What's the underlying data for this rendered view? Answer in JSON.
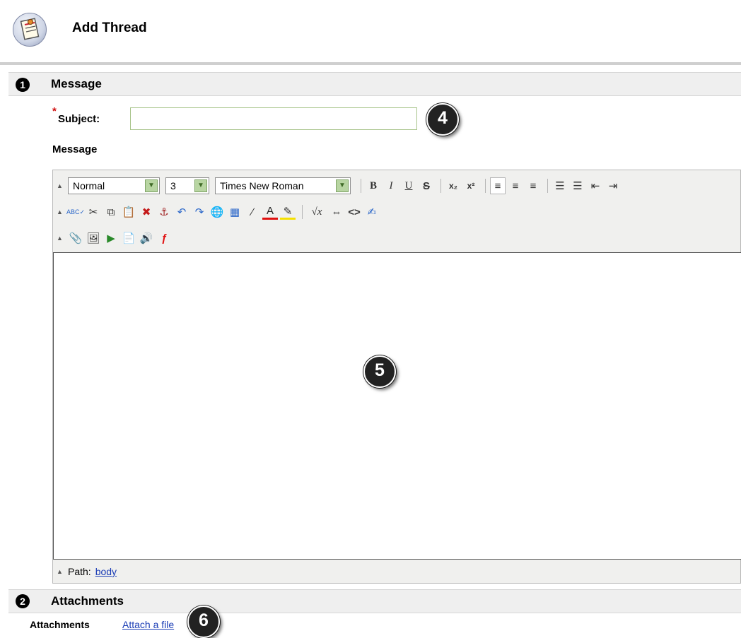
{
  "header": {
    "title": "Add Thread",
    "icon": "discussion-thread-icon"
  },
  "sections": {
    "message": {
      "number": "1",
      "title": "Message"
    },
    "attachments": {
      "number": "2",
      "title": "Attachments"
    }
  },
  "form": {
    "required_marker": "*",
    "subject_label": "Subject:",
    "subject_value": "",
    "message_label": "Message"
  },
  "editor": {
    "format_select": "Normal",
    "size_select": "3",
    "font_select": "Times New Roman",
    "row1": {
      "bold": "B",
      "italic": "I",
      "underline": "U",
      "strike": "S",
      "subscript": "x₂",
      "superscript": "x²",
      "align_left": "≡",
      "align_center": "≡",
      "align_right": "≡",
      "ordered_list": "☰",
      "unordered_list": "☰",
      "outdent": "⇤",
      "indent": "⇥"
    },
    "row2": {
      "spellcheck": "ABC✓",
      "cut": "✂",
      "copy": "⧉",
      "paste": "📋",
      "remove_format": "✖",
      "anchor": "⚓",
      "undo": "↶",
      "redo": "↷",
      "link": "🌐",
      "table": "▦",
      "pen": "∕",
      "text_color": "A",
      "highlight": "✎",
      "math": "√x",
      "code_embed": "⇔",
      "html": "<>",
      "spell_edit": "✍"
    },
    "row3": {
      "attach_file": "📎",
      "image": "🖼",
      "media": "▶",
      "document": "📄",
      "audio": "🔊",
      "flash": "ƒ"
    },
    "status": {
      "path_label": "Path:",
      "path_value": "body"
    }
  },
  "attachments": {
    "label": "Attachments",
    "link": "Attach a file"
  },
  "callouts": {
    "c4": "4",
    "c5": "5",
    "c6": "6"
  },
  "colors": {
    "accent_link": "#1a3cb5",
    "required": "#d01010",
    "section_bg": "#efefef"
  }
}
